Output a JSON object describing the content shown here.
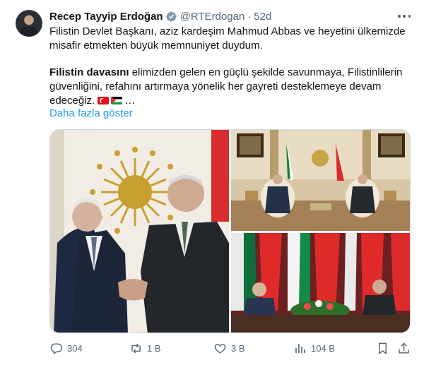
{
  "author": {
    "name": "Recep Tayyip Erdoğan",
    "handle": "@RTErdogan",
    "separator": "·",
    "time": "52d"
  },
  "tweet": {
    "paragraph1": "Filistin Devlet Başkanı, aziz kardeşim Mahmud Abbas ve heyetini ülkemizde misafir etmekten büyük memnuniyet duydum.",
    "paragraph2_bold": "Filistin davasını",
    "paragraph2_rest": " elimizden gelen en güçlü şekilde savunmaya, Filistinlilerin güvenliğini, refahını artırmaya yönelik her gayreti desteklemeye devam edeceğiz.",
    "ellipsis": "…",
    "show_more": "Daha fazla göster"
  },
  "actions": {
    "replies": "304",
    "reposts": "1 B",
    "likes": "3 B",
    "views": "104 B"
  },
  "icons": {
    "verified": "verified-badge-icon",
    "more": "more-options-icon",
    "reply": "reply-icon",
    "repost": "repost-icon",
    "like": "heart-icon",
    "views": "analytics-icon",
    "bookmark": "bookmark-icon",
    "share": "share-icon",
    "flags": [
      "flag-turkey-icon",
      "flag-palestine-icon"
    ]
  },
  "colors": {
    "text": "#0f1419",
    "secondary": "#536471",
    "link": "#1d9bf0",
    "border": "#cfd9de"
  }
}
